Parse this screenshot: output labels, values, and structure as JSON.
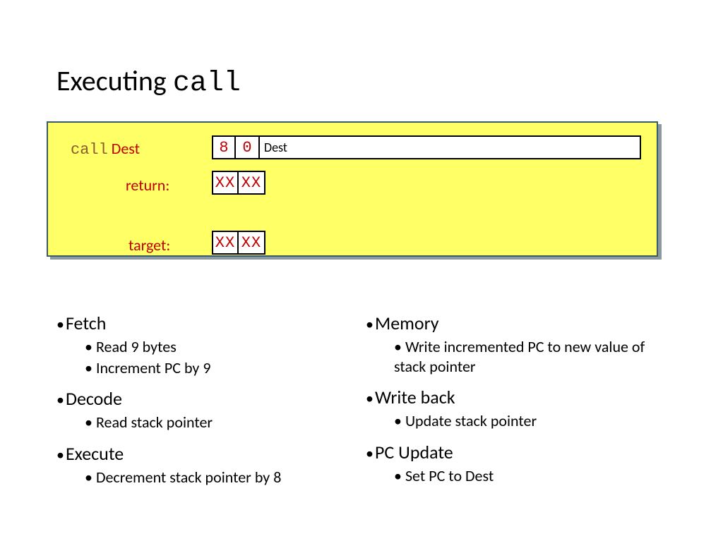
{
  "title_prefix": "Executing ",
  "title_mono": "call",
  "encoding": {
    "label_mono": "call",
    "label_dest": " Dest",
    "cell0": "8",
    "cell1": "0",
    "wide": "Dest"
  },
  "return": {
    "label": "return:",
    "c0": "XX",
    "c1": "XX"
  },
  "target": {
    "label": "target:",
    "c0": "XX",
    "c1": "XX"
  },
  "left": {
    "fetch_h": "Fetch",
    "fetch_1": "Read 9 bytes",
    "fetch_2": "Increment PC by 9",
    "decode_h": "Decode",
    "decode_1": "Read stack pointer",
    "execute_h": "Execute",
    "execute_1": "Decrement stack pointer by 8"
  },
  "right": {
    "memory_h": "Memory",
    "memory_1": "Write incremented PC to new value of stack pointer",
    "wb_h": "Write back",
    "wb_1": "Update stack pointer",
    "pc_h": "PC Update",
    "pc_1": "Set PC to Dest"
  }
}
